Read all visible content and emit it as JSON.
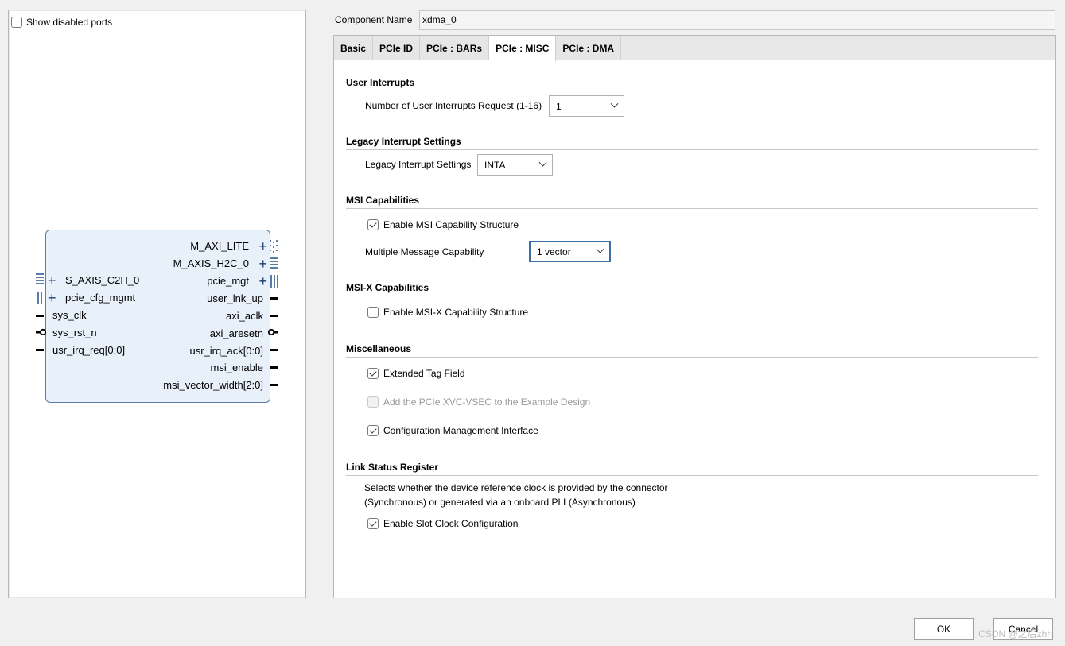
{
  "left": {
    "show_disabled_label": "Show disabled ports",
    "ports_left": [
      {
        "label": "S_AXIS_C2H_0"
      },
      {
        "label": "pcie_cfg_mgmt"
      },
      {
        "label": "sys_clk"
      },
      {
        "label": "sys_rst_n"
      },
      {
        "label": "usr_irq_req[0:0]"
      }
    ],
    "ports_right": [
      {
        "label": "M_AXI_LITE"
      },
      {
        "label": "M_AXIS_H2C_0"
      },
      {
        "label": "pcie_mgt"
      },
      {
        "label": "user_lnk_up"
      },
      {
        "label": "axi_aclk"
      },
      {
        "label": "axi_aresetn"
      },
      {
        "label": "usr_irq_ack[0:0]"
      },
      {
        "label": "msi_enable"
      },
      {
        "label": "msi_vector_width[2:0]"
      }
    ]
  },
  "component": {
    "label": "Component Name",
    "value": "xdma_0"
  },
  "tabs": [
    "Basic",
    "PCIe ID",
    "PCIe : BARs",
    "PCIe : MISC",
    "PCIe : DMA"
  ],
  "active_tab": "PCIe : MISC",
  "sections": {
    "user_interrupts": {
      "title": "User Interrupts",
      "request_label": "Number of User Interrupts Request (1-16)",
      "request_value": "1"
    },
    "legacy": {
      "title": "Legacy Interrupt Settings",
      "label": "Legacy Interrupt Settings",
      "value": "INTA"
    },
    "msi": {
      "title": "MSI Capabilities",
      "enable_label": "Enable MSI Capability Structure",
      "enable_checked": true,
      "mmc_label": "Multiple Message Capability",
      "mmc_value": "1 vector"
    },
    "msix": {
      "title": "MSI-X Capabilities",
      "enable_label": "Enable MSI-X Capability Structure",
      "enable_checked": false
    },
    "misc": {
      "title": "Miscellaneous",
      "ext_tag_label": "Extended Tag Field",
      "ext_tag_checked": true,
      "xvc_label": "Add the PCIe XVC-VSEC to the Example Design",
      "xvc_checked": false,
      "cfg_mgmt_label": "Configuration Management Interface",
      "cfg_mgmt_checked": true
    },
    "link_status": {
      "title": "Link Status Register",
      "desc_line1": "Selects whether the device reference clock is provided by the connector",
      "desc_line2": "(Synchronous) or generated via an onboard PLL(Asynchronous)",
      "slot_clock_label": "Enable Slot Clock Configuration",
      "slot_clock_checked": true
    }
  },
  "buttons": {
    "ok": "OK",
    "cancel": "Cancel"
  },
  "watermark": "CSDN @之后zhh"
}
